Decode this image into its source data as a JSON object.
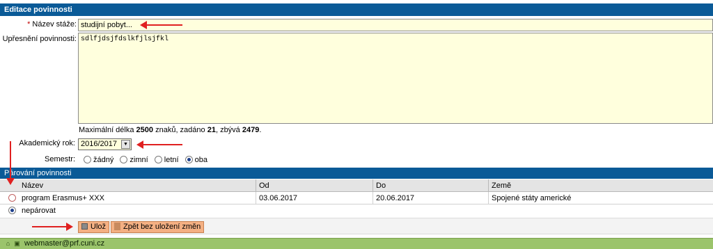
{
  "window": {
    "title": "Editace povinnosti"
  },
  "form": {
    "name_label_required": "*",
    "name_label": "Název stáže:",
    "name_value": "studijní pobyt...",
    "desc_label": "Upřesnění povinnosti:",
    "desc_value": "sdlfjdsjfdslkfjlsjfkl",
    "note_prefix": "Maximální délka ",
    "note_max": "2500",
    "note_mid1": " znaků, zadáno ",
    "note_entered": "21",
    "note_mid2": ", zbývá ",
    "note_remaining": "2479",
    "note_suffix": ".",
    "year_label": "Akademický rok:",
    "year_value": "2016/2017",
    "semester_label": "Semestr:",
    "semester_options": [
      {
        "label": "žádný",
        "selected": false
      },
      {
        "label": "zimní",
        "selected": false
      },
      {
        "label": "letní",
        "selected": false
      },
      {
        "label": "oba",
        "selected": true
      }
    ]
  },
  "pairing": {
    "title": "Párování povinnosti",
    "columns": [
      "Název",
      "Od",
      "Do",
      "Země"
    ],
    "rows": [
      {
        "name": "program Erasmus+ XXX",
        "from": "03.06.2017",
        "to": "20.06.2017",
        "country": "Spojené státy americké",
        "selected": false
      },
      {
        "name": "nepárovat",
        "selected": true
      }
    ]
  },
  "buttons": {
    "save": "Ulož",
    "back": "Zpět bez uložení změn"
  },
  "footer": {
    "email": "webmaster@prf.cuni.cz"
  },
  "colors": {
    "header_blue": "#0a5a97",
    "input_bg": "#ffffdd",
    "button_orange": "#f4b083",
    "footer_green": "#9bc46b",
    "annotation_red": "#e02020"
  }
}
